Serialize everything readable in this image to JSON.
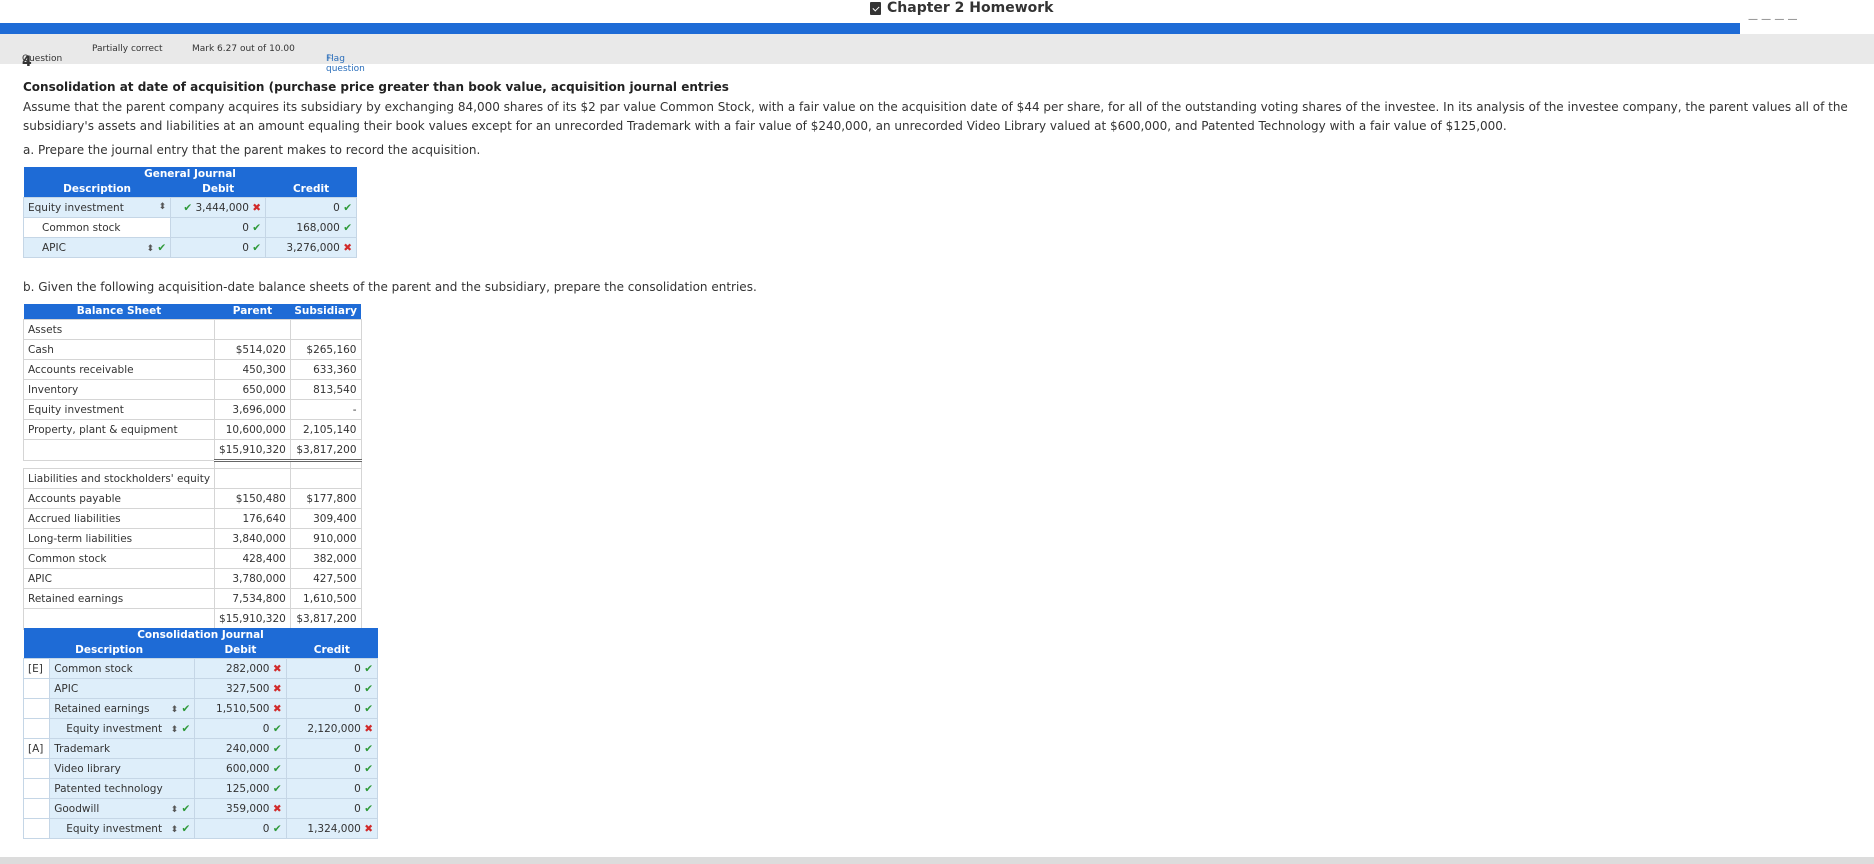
{
  "header": {
    "title": "Chapter 2 Homework",
    "right_text": "— — — —"
  },
  "question": {
    "label": "Question",
    "number": "4",
    "status": "Partially correct",
    "mark": "Mark 6.27 out of 10.00",
    "flag": "Flag question"
  },
  "problem": {
    "title": "Consolidation at date of acquisition (purchase price greater than book value, acquisition journal entries",
    "text": "Assume that the parent company acquires its subsidiary by exchanging 84,000 shares of its $2 par value Common Stock, with a fair value on the acquisition date of $44 per share, for all of the outstanding voting shares of the investee. In its analysis of the investee company, the parent values all of the subsidiary's assets and liabilities at an amount equaling their book values except for an unrecorded Trademark with a fair value of $240,000, an unrecorded Video Library valued at $600,000, and Patented Technology with a fair value of $125,000.",
    "part_a": "a. Prepare the journal entry that the parent makes to record the acquisition.",
    "part_b": "b. Given the following acquisition-date balance sheets of the parent and the subsidiary, prepare the consolidation entries."
  },
  "general_journal": {
    "title": "General Journal",
    "headers": [
      "Description",
      "Debit",
      "Credit"
    ],
    "rows": [
      {
        "desc": "Equity investment",
        "debit": "3,444,000",
        "credit": "0"
      },
      {
        "desc": "Common stock",
        "debit": "0",
        "credit": "168,000"
      },
      {
        "desc": "APIC",
        "debit": "0",
        "credit": "3,276,000"
      }
    ]
  },
  "balance_sheet": {
    "headers": [
      "Balance Sheet",
      "Parent",
      "Subsidiary"
    ],
    "assets_label": "Assets",
    "assets": [
      {
        "label": "Cash",
        "parent": "$514,020",
        "sub": "$265,160"
      },
      {
        "label": "Accounts receivable",
        "parent": "450,300",
        "sub": "633,360"
      },
      {
        "label": "Inventory",
        "parent": "650,000",
        "sub": "813,540"
      },
      {
        "label": "Equity investment",
        "parent": "3,696,000",
        "sub": "-"
      },
      {
        "label": "Property, plant & equipment",
        "parent": "10,600,000",
        "sub": "2,105,140"
      }
    ],
    "assets_total": {
      "parent": "$15,910,320",
      "sub": "$3,817,200"
    },
    "liab_label": "Liabilities and stockholders' equity",
    "liabilities": [
      {
        "label": "Accounts payable",
        "parent": "$150,480",
        "sub": "$177,800"
      },
      {
        "label": "Accrued liabilities",
        "parent": "176,640",
        "sub": "309,400"
      },
      {
        "label": "Long-term liabilities",
        "parent": "3,840,000",
        "sub": "910,000"
      },
      {
        "label": "Common stock",
        "parent": "428,400",
        "sub": "382,000"
      },
      {
        "label": "APIC",
        "parent": "3,780,000",
        "sub": "427,500"
      },
      {
        "label": "Retained earnings",
        "parent": "7,534,800",
        "sub": "1,610,500"
      }
    ],
    "liab_total": {
      "parent": "$15,910,320",
      "sub": "$3,817,200"
    }
  },
  "consolidation_journal": {
    "title": "Consolidation Journal",
    "headers": [
      "Description",
      "Debit",
      "Credit"
    ],
    "rows": [
      {
        "tag": "[E]",
        "desc": "Common stock",
        "debit": "282,000",
        "credit": "0"
      },
      {
        "tag": "",
        "desc": "APIC",
        "debit": "327,500",
        "credit": "0"
      },
      {
        "tag": "",
        "desc": "Retained earnings",
        "debit": "1,510,500",
        "credit": "0"
      },
      {
        "tag": "",
        "desc": "Equity investment",
        "debit": "0",
        "credit": "2,120,000"
      },
      {
        "tag": "[A]",
        "desc": "Trademark",
        "debit": "240,000",
        "credit": "0"
      },
      {
        "tag": "",
        "desc": "Video library",
        "debit": "600,000",
        "credit": "0"
      },
      {
        "tag": "",
        "desc": "Patented technology",
        "debit": "125,000",
        "credit": "0"
      },
      {
        "tag": "",
        "desc": "Goodwill",
        "debit": "359,000",
        "credit": "0"
      },
      {
        "tag": "",
        "desc": "Equity investment",
        "debit": "0",
        "credit": "1,324,000"
      }
    ]
  },
  "icons": {
    "correct": "check-icon",
    "incorrect": "x-icon",
    "select": "updown-arrows-icon",
    "doc": "document-check-icon",
    "flag": "flag-icon"
  },
  "colors": {
    "accent": "#1e6bd6",
    "correct": "#2f9a3a",
    "incorrect": "#d12b2b",
    "input_bg": "#deeefa"
  }
}
